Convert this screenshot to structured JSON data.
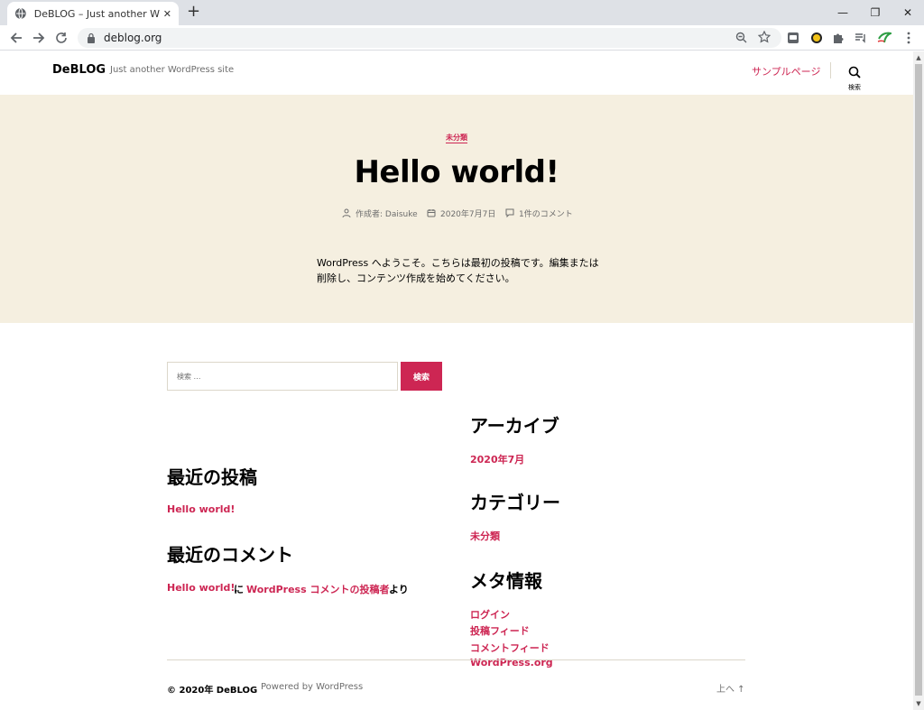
{
  "browser": {
    "tab_title": "DeBLOG – Just another WordPress site",
    "tab_close": "✕",
    "new_tab": "+",
    "url": "deblog.org",
    "win_minimize": "—",
    "win_restore": "❐",
    "win_close": "✕"
  },
  "site": {
    "title": "DeBLOG",
    "description": "Just another WordPress site",
    "menu_item": "サンプルページ",
    "search_label": "検索"
  },
  "post": {
    "category": "未分類",
    "title": "Hello world!",
    "author": "作成者: Daisuke",
    "date": "2020年7月7日",
    "comments": "1件のコメント",
    "excerpt": "WordPress へようこそ。こちらは最初の投稿です。編集または削除し、コンテンツ作成を始めてください。"
  },
  "widgets": {
    "search_placeholder": "検索 …",
    "search_button": "検索",
    "recent_posts_heading": "最近の投稿",
    "recent_post": "Hello world!",
    "recent_comments_heading": "最近のコメント",
    "comment_post": "Hello world!",
    "comment_on": "に",
    "comment_author": "WordPress コメントの投稿者",
    "comment_from": "より",
    "archives_heading": "アーカイブ",
    "archive_item": "2020年7月",
    "categories_heading": "カテゴリー",
    "category_item": "未分類",
    "meta_heading": "メタ情報",
    "meta_items": [
      "ログイン",
      "投稿フィード",
      "コメントフィード",
      "WordPress.org"
    ]
  },
  "footer": {
    "copyright": "© 2020年 DeBLOG",
    "powered": "Powered by WordPress",
    "to_top": "上へ ↑"
  },
  "colors": {
    "accent": "#cd2653",
    "hero_bg": "#f5efe0",
    "muted": "#6d6d6d"
  }
}
